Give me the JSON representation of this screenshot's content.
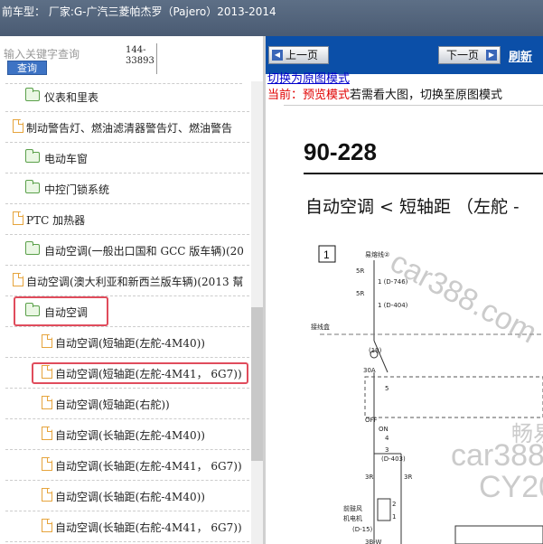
{
  "header": {
    "title": "前车型： 厂家:G-广汽三菱帕杰罗（Pajero）2013-2014"
  },
  "search": {
    "placeholder": "输入关键字查询",
    "button_label": "查询",
    "code_line1": "144-",
    "code_line2": "33893"
  },
  "tree": [
    {
      "label": "仪表和里表",
      "icon": "folder-icon",
      "highlighted": false
    },
    {
      "label": "制动警告灯、燃油滤清器警告灯、燃油警告",
      "icon": "document-icon",
      "highlighted": false
    },
    {
      "label": "电动车窗",
      "icon": "folder-icon",
      "highlighted": false
    },
    {
      "label": "中控门锁系统",
      "icon": "folder-icon",
      "highlighted": false
    },
    {
      "label": "PTC 加热器",
      "icon": "document-icon",
      "highlighted": false
    },
    {
      "label": "自动空调(一般出口国和 GCC 版车辆)(20",
      "icon": "folder-icon",
      "highlighted": false
    },
    {
      "label": "自动空调(澳大利亚和新西兰版车辆)(2013 幫",
      "icon": "document-icon",
      "highlighted": false
    },
    {
      "label": "自动空调",
      "icon": "folder-open-icon",
      "highlighted": true
    },
    {
      "label": "自动空调(短轴距(左舵-4M40))",
      "icon": "document-icon",
      "highlighted": false
    },
    {
      "label": "自动空调(短轴距(左舵-4M41， 6G7))",
      "icon": "document-icon",
      "highlighted": true
    },
    {
      "label": "自动空调(短轴距(右舵))",
      "icon": "document-icon",
      "highlighted": false
    },
    {
      "label": "自动空调(长轴距(左舵-4M40))",
      "icon": "document-icon",
      "highlighted": false
    },
    {
      "label": "自动空调(长轴距(左舵-4M41， 6G7))",
      "icon": "document-icon",
      "highlighted": false
    },
    {
      "label": "自动空调(长轴距(右舵-4M40))",
      "icon": "document-icon",
      "highlighted": false
    },
    {
      "label": "自动空调(长轴距(右舵-4M41， 6G7))",
      "icon": "document-icon",
      "highlighted": false
    }
  ],
  "viewer": {
    "prev_label": "上一页",
    "next_label": "下一页",
    "refresh_label": "刷新",
    "switch_link": "切换为原图模式",
    "current_prefix": "当前：预览模式",
    "current_suffix": "若需看大图，切换至原图模式",
    "page_number": "90-228",
    "diagram_title": "自动空调 < 短轴距 （左舵 -",
    "box_label": "1",
    "fuse_label": "易熔线②",
    "wire_labels": [
      "5R",
      "5R",
      "接线盒",
      "30A",
      "5",
      "OFF",
      "ON",
      "4",
      "3",
      "3R",
      "3R",
      "前鼓风",
      "机电机",
      "2",
      "1",
      "3B-W"
    ],
    "connector_labels": [
      "1 (D-746)",
      "1 (D-404)",
      "(19)",
      "(D-403)",
      "(D-15)"
    ],
    "watermarks": [
      "car388.com",
      "畅易",
      "car388.",
      "CY20"
    ]
  },
  "colors": {
    "navbar": "#0b4fa8",
    "highlight": "#e04c5c",
    "link": "#0000cc",
    "status": "#e00000"
  }
}
